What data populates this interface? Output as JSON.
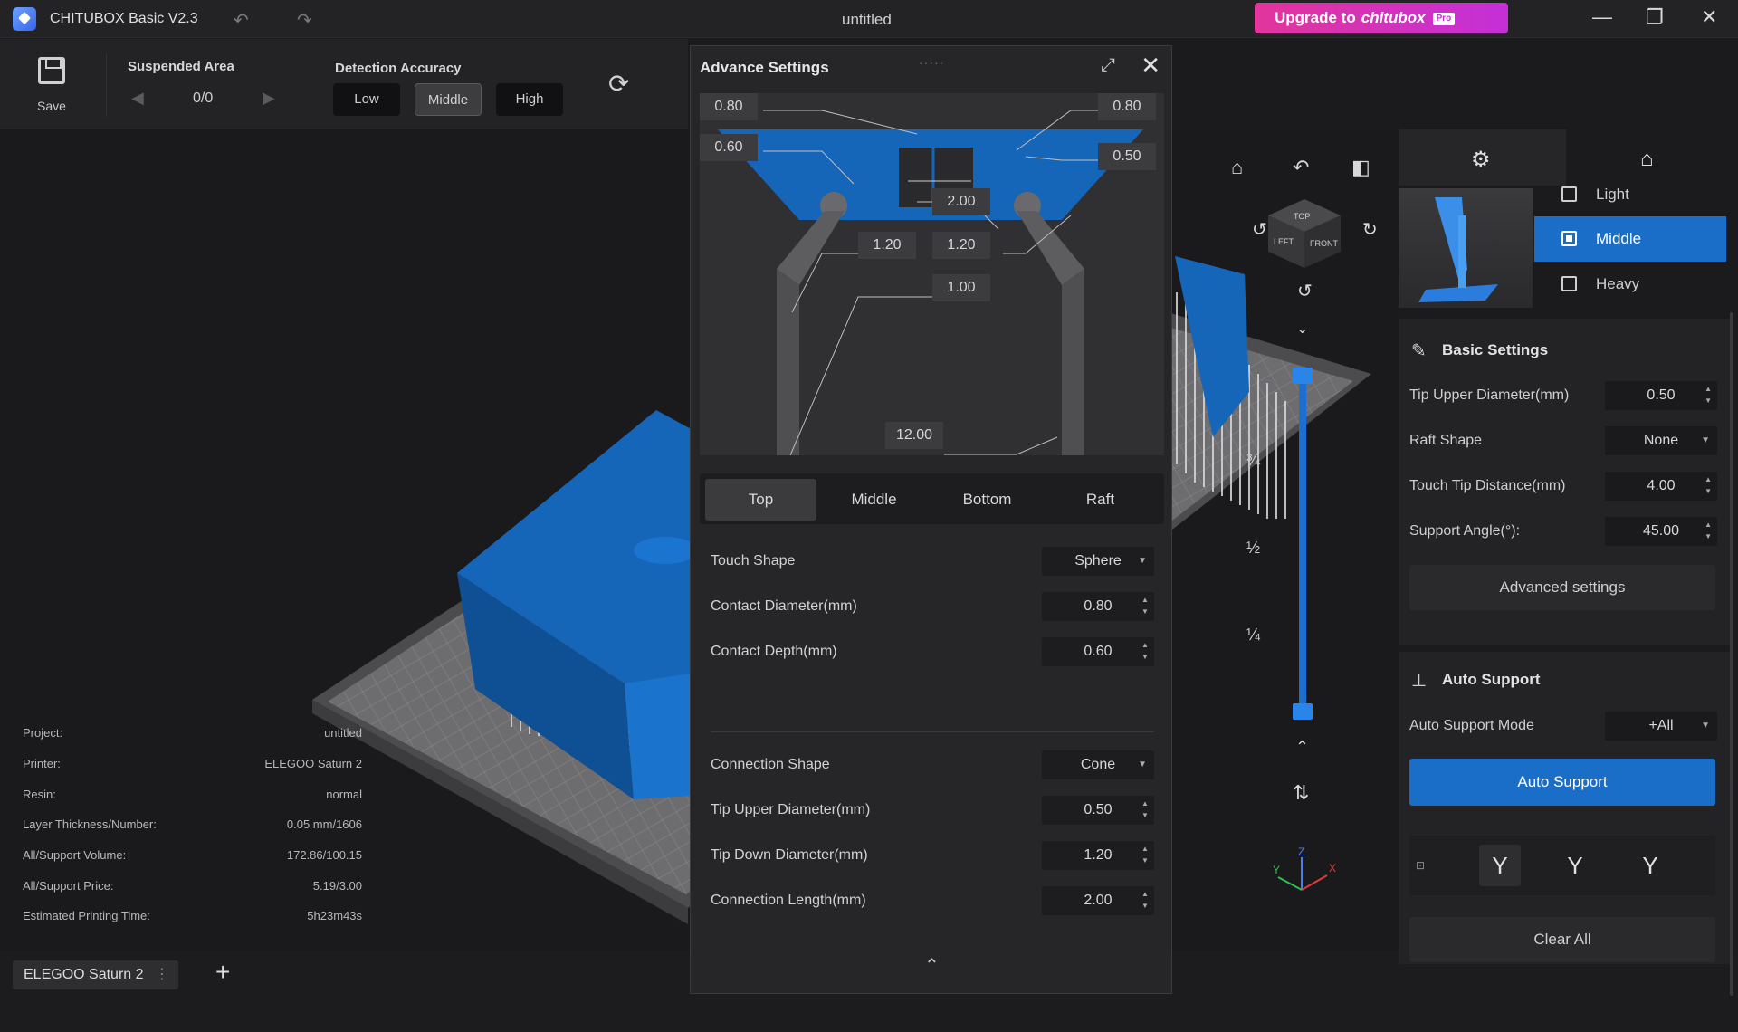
{
  "app": {
    "title": "CHITUBOX Basic V2.3",
    "document_title": "untitled",
    "upgrade_text": "Upgrade to",
    "upgrade_brand": "chitubox",
    "upgrade_badge": "Pro",
    "undo_icon": "↶",
    "redo_icon": "↷",
    "minimize_icon": "—",
    "restore_icon": "❐",
    "close_icon": "✕"
  },
  "toolbar": {
    "save_label": "Save",
    "suspended_area_title": "Suspended Area",
    "prev_icon": "◀",
    "next_icon": "▶",
    "counter": "0/0",
    "detection_title": "Detection Accuracy",
    "accuracy_options": [
      "Low",
      "Middle",
      "High"
    ],
    "accuracy_selected": "Middle",
    "refresh_icon": "⟳"
  },
  "project_info": [
    {
      "key": "Project:",
      "value": "untitled"
    },
    {
      "key": "Printer:",
      "value": "ELEGOO Saturn 2"
    },
    {
      "key": "Resin:",
      "value": "normal"
    },
    {
      "key": "Layer Thickness/Number:",
      "value": "0.05 mm/1606"
    },
    {
      "key": "All/Support Volume:",
      "value": "172.86/100.15"
    },
    {
      "key": "All/Support Price:",
      "value": "5.19/3.00"
    },
    {
      "key": "Estimated Printing Time:",
      "value": "5h23m43s"
    }
  ],
  "bottom": {
    "printer_tab": "ELEGOO Saturn 2",
    "tab_menu_icon": "⋮",
    "add_icon": "+"
  },
  "advance": {
    "title": "Advance Settings",
    "drag_handle": "·····",
    "expand_icon": "⤢",
    "close_icon": "✕",
    "diagram_labels": {
      "top_left": "0.80",
      "mid_left": "0.60",
      "top_right": "0.80",
      "mid_right": "0.50",
      "conn_len": "2.00",
      "down_left": "1.20",
      "down_right": "1.20",
      "body": "1.00",
      "raft": "12.00"
    },
    "tabs": [
      "Top",
      "Middle",
      "Bottom",
      "Raft"
    ],
    "active_tab": "Top",
    "rows": [
      {
        "label": "Touch Shape",
        "value": "Sphere",
        "kind": "select"
      },
      {
        "label": "Contact Diameter(mm)",
        "value": "0.80",
        "kind": "spin"
      },
      {
        "label": "Contact Depth(mm)",
        "value": "0.60",
        "kind": "spin"
      },
      {
        "label": "Connection Shape",
        "value": "Cone",
        "kind": "select"
      },
      {
        "label": "Tip Upper Diameter(mm)",
        "value": "0.50",
        "kind": "spin"
      },
      {
        "label": "Tip Down Diameter(mm)",
        "value": "1.20",
        "kind": "spin"
      },
      {
        "label": "Connection Length(mm)",
        "value": "2.00",
        "kind": "spin"
      }
    ],
    "collapse_icon": "⌃"
  },
  "viewport": {
    "fractions": [
      "¾",
      "½",
      "¼"
    ],
    "home_icon": "⌂",
    "rotate_icon": "↶",
    "cube_icon": "◧",
    "nav_cube_faces": [
      "TOP",
      "LEFT",
      "FRONT"
    ],
    "slider_up_icon": "⌃",
    "slider_down_icon": "⌄",
    "swap_icon": "⇅",
    "axes": [
      "Y",
      "Z",
      "X"
    ]
  },
  "right": {
    "density_options": [
      "Light",
      "Middle",
      "Heavy"
    ],
    "density_selected": "Middle",
    "basic_title": "Basic Settings",
    "basic_rows": [
      {
        "label": "Tip Upper Diameter(mm)",
        "value": "0.50",
        "kind": "spin"
      },
      {
        "label": "Raft Shape",
        "value": "None",
        "kind": "select"
      },
      {
        "label": "Touch Tip Distance(mm)",
        "value": "4.00",
        "kind": "spin"
      },
      {
        "label": "Support Angle(°):",
        "value": "45.00",
        "kind": "spin"
      }
    ],
    "advanced_button": "Advanced settings",
    "auto_title": "Auto Support",
    "auto_mode_label": "Auto Support Mode",
    "auto_mode_value": "+All",
    "auto_button": "Auto Support",
    "clear_button": "Clear All"
  },
  "colors": {
    "accent": "#1a6ec8",
    "model_blue": "#1565b8",
    "upgrade_gradient_start": "#e2359c",
    "upgrade_gradient_end": "#c42fd7"
  }
}
